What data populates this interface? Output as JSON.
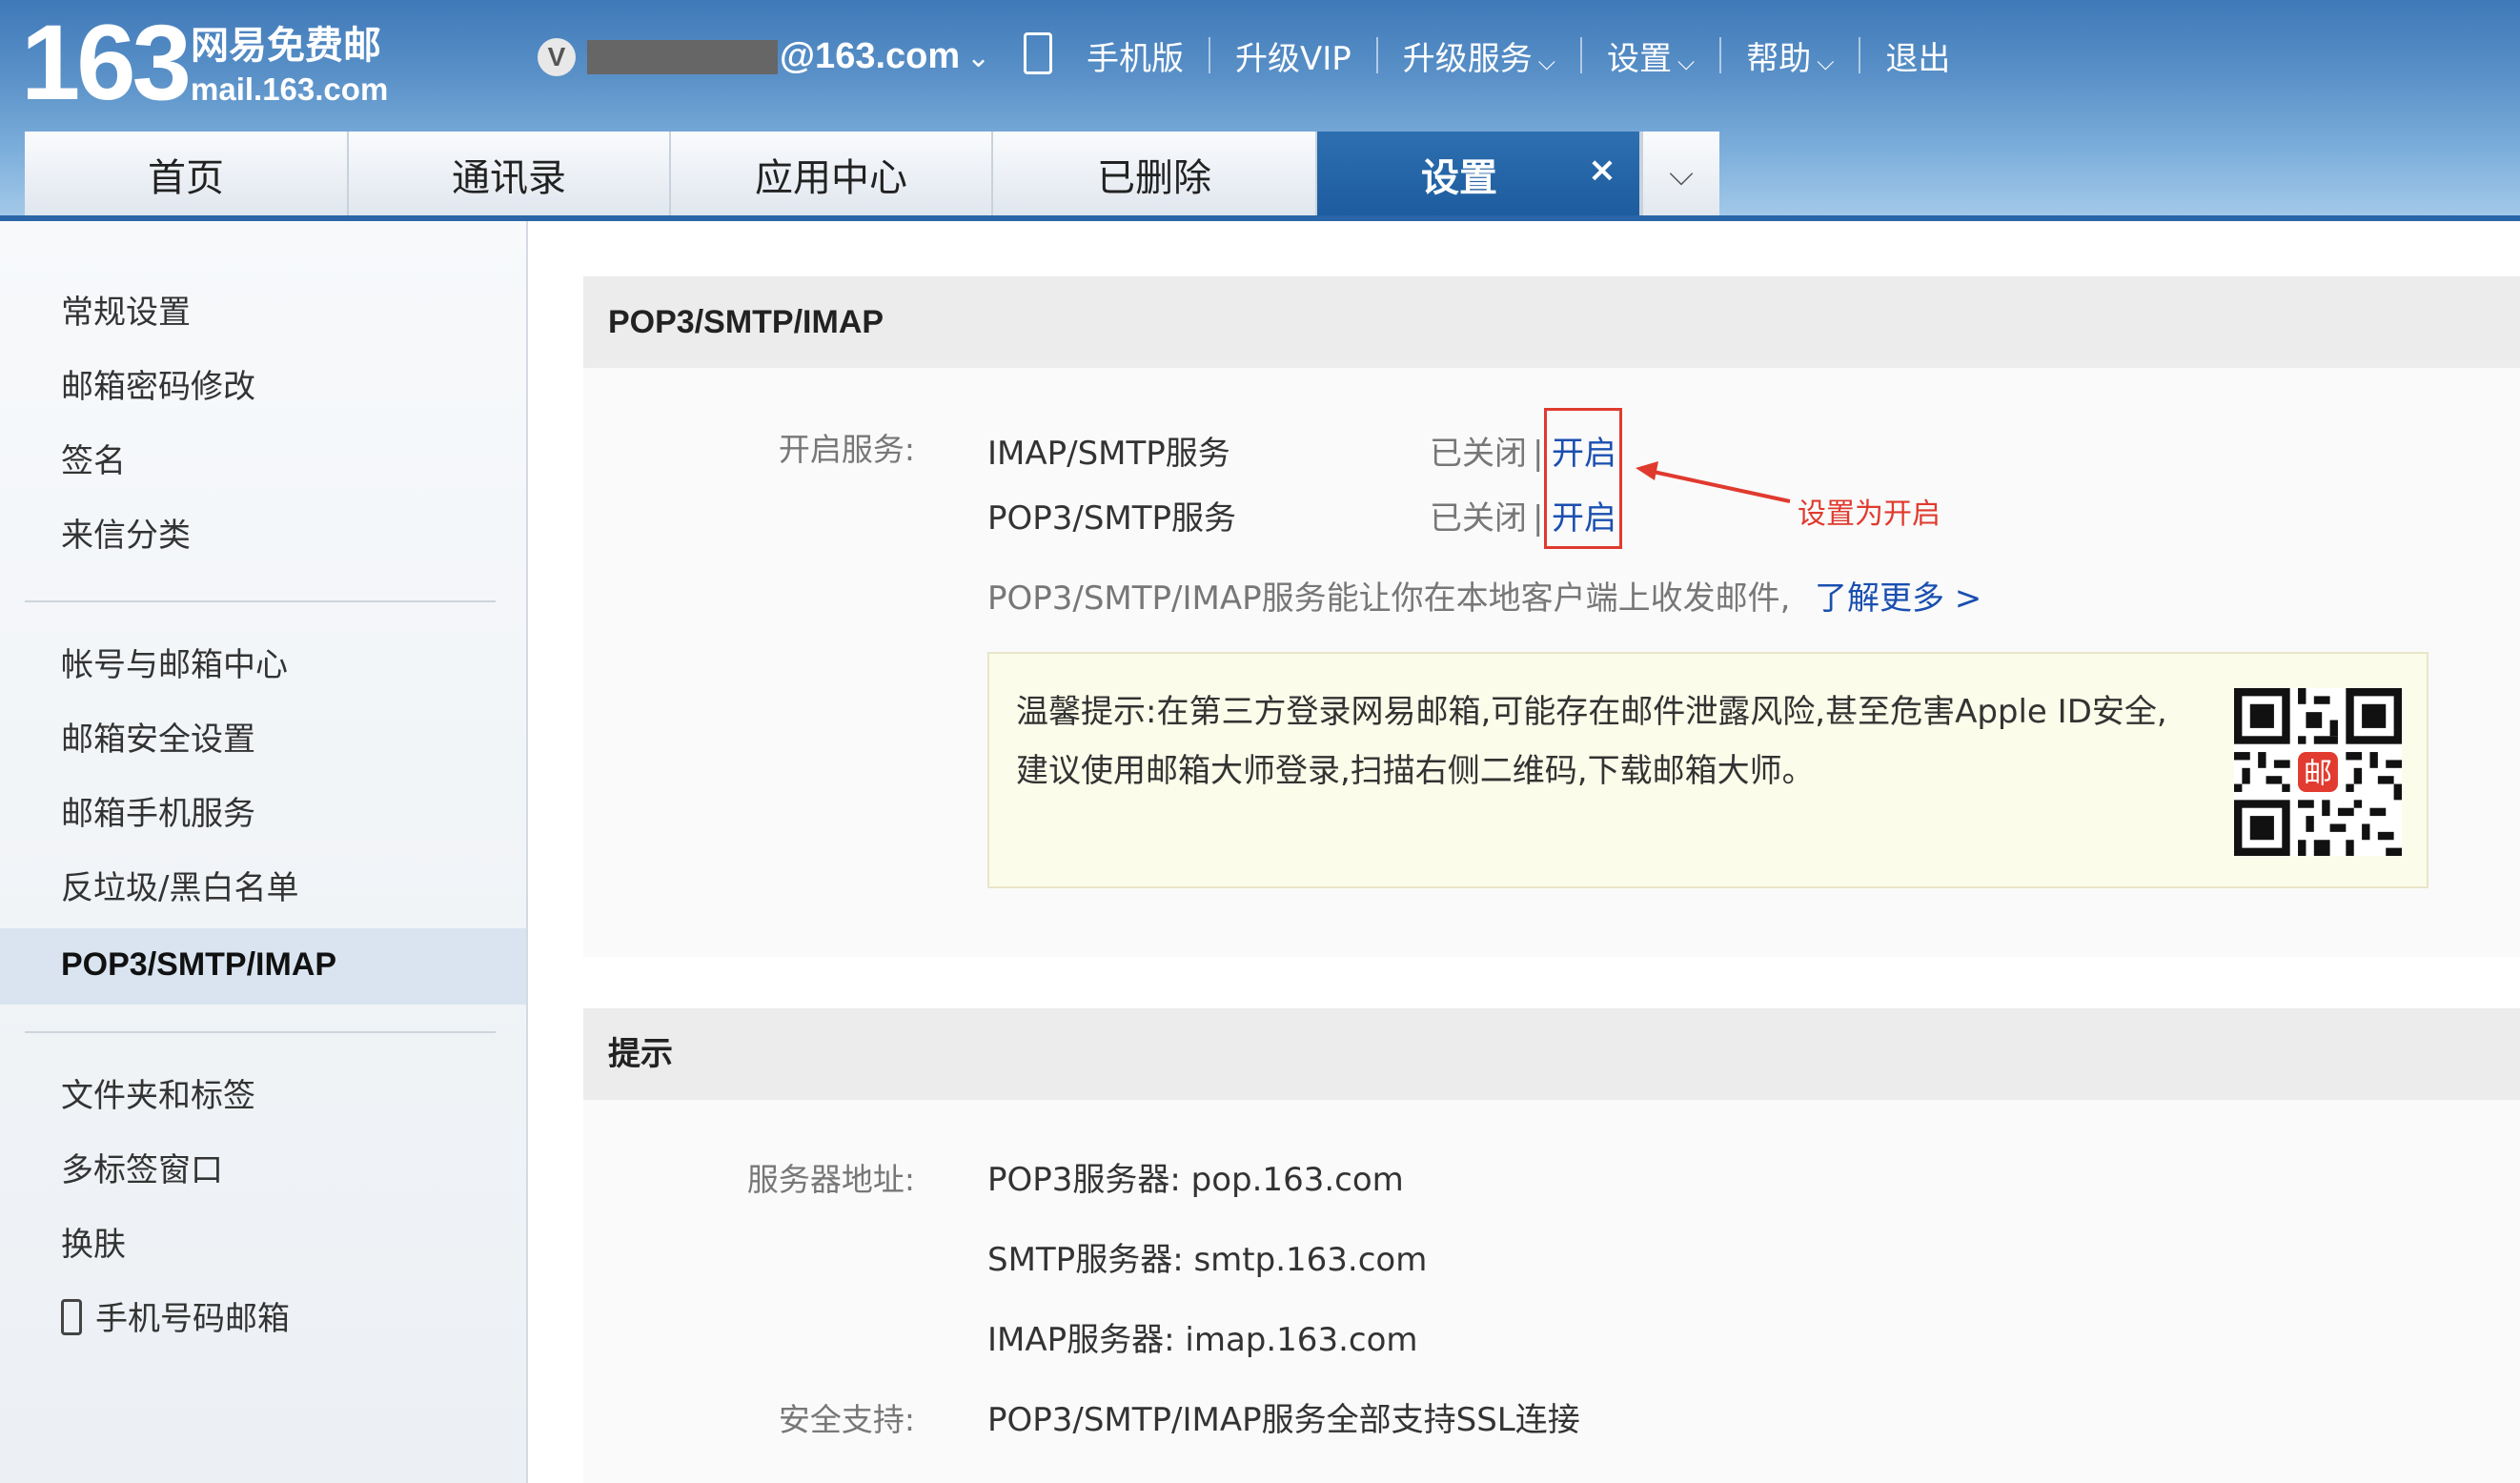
{
  "header": {
    "logo_number": "163",
    "logo_cn": "网易免费邮",
    "logo_en": "mail.163.com",
    "vip_badge": "V",
    "account_domain": "@163.com",
    "nav": [
      {
        "label": "手机版"
      },
      {
        "label": "升级VIP"
      },
      {
        "label": "升级服务"
      },
      {
        "label": "设置"
      },
      {
        "label": "帮助"
      },
      {
        "label": "退出"
      }
    ]
  },
  "tabs": [
    {
      "label": "首页"
    },
    {
      "label": "通讯录"
    },
    {
      "label": "应用中心"
    },
    {
      "label": "已删除"
    },
    {
      "label": "设置",
      "active": true
    }
  ],
  "tab_close": "×",
  "sidebar": {
    "group1": [
      "常规设置",
      "邮箱密码修改",
      "签名",
      "来信分类"
    ],
    "group2": [
      "帐号与邮箱中心",
      "邮箱安全设置",
      "邮箱手机服务",
      "反垃圾/黑白名单",
      "POP3/SMTP/IMAP"
    ],
    "group3": [
      "文件夹和标签",
      "多标签窗口",
      "换肤",
      "手机号码邮箱"
    ],
    "active": "POP3/SMTP/IMAP"
  },
  "pop_panel": {
    "title": "POP3/SMTP/IMAP",
    "service_label": "开启服务:",
    "services": [
      {
        "name": "IMAP/SMTP服务",
        "status": "已关闭",
        "sep": "|",
        "action": "开启"
      },
      {
        "name": "POP3/SMTP服务",
        "status": "已关闭",
        "sep": "|",
        "action": "开启"
      }
    ],
    "annotation": "设置为开启",
    "desc": "POP3/SMTP/IMAP服务能让你在本地客户端上收发邮件,",
    "learn_more": "了解更多 >",
    "tip": "温馨提示:在第三方登录网易邮箱,可能存在邮件泄露风险,甚至危害Apple ID安全,建议使用邮箱大师登录,扫描右侧二维码,下载邮箱大师。",
    "qr_badge": "邮"
  },
  "hint_panel": {
    "title": "提示",
    "server_label": "服务器地址:",
    "servers": [
      "POP3服务器: pop.163.com",
      "SMTP服务器: smtp.163.com",
      "IMAP服务器: imap.163.com"
    ],
    "security_label": "安全支持:",
    "security_value": "POP3/SMTP/IMAP服务全部支持SSL连接"
  },
  "colors": {
    "header_blue": "#3f79b8",
    "active_tab": "#1d5c9e",
    "link": "#1a4fb0",
    "annotation_red": "#e03a2e"
  }
}
